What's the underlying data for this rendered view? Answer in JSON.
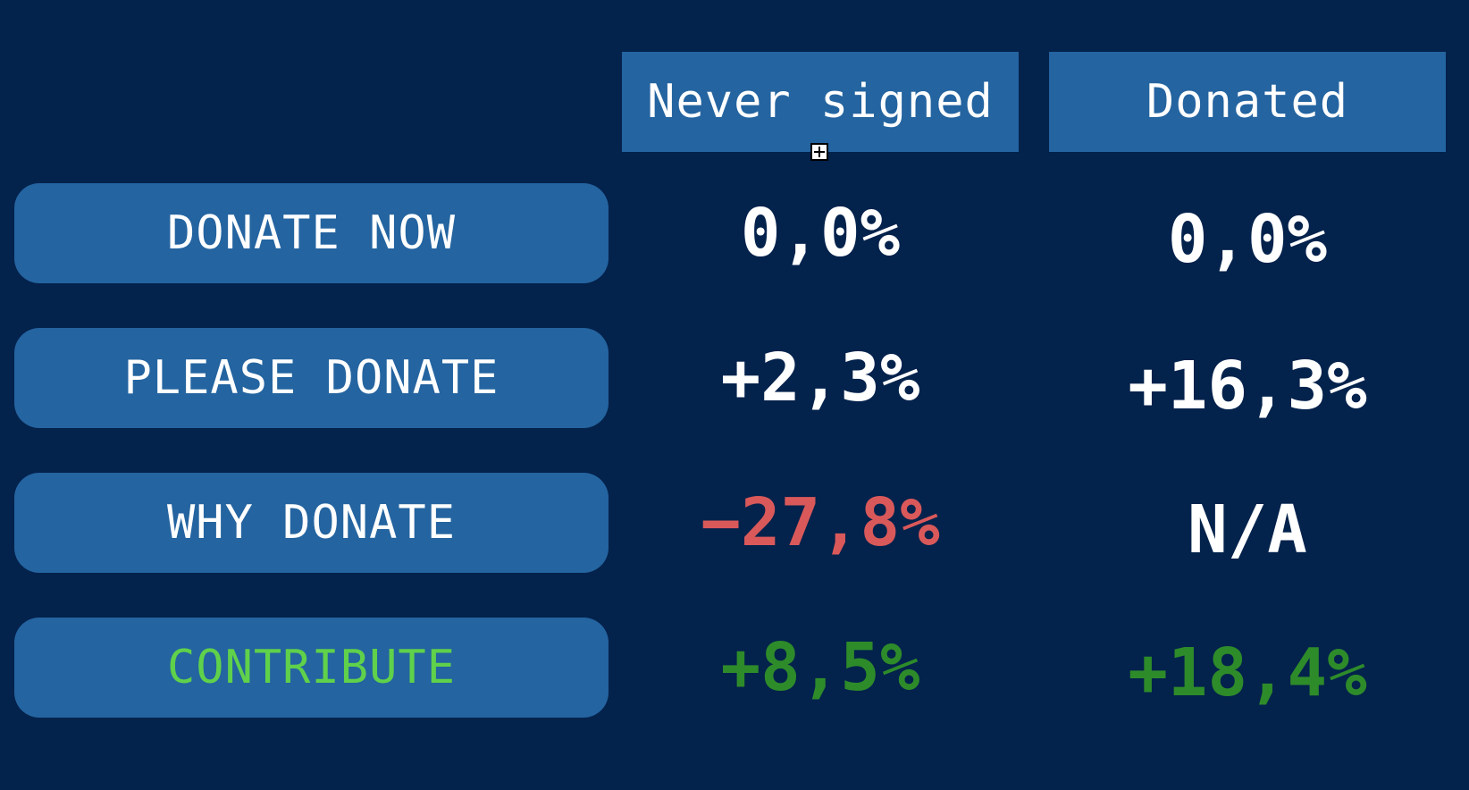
{
  "columns": [
    {
      "label": "Never signed"
    },
    {
      "label": "Donated"
    }
  ],
  "rows": [
    {
      "label": "DONATE NOW",
      "label_color": "#ffffff",
      "values": [
        "0,0%",
        "0,0%"
      ],
      "value_colors": [
        "#ffffff",
        "#ffffff"
      ]
    },
    {
      "label": "PLEASE DONATE",
      "label_color": "#ffffff",
      "values": [
        "+2,3%",
        "+16,3%"
      ],
      "value_colors": [
        "#ffffff",
        "#ffffff"
      ]
    },
    {
      "label": "WHY DONATE",
      "label_color": "#ffffff",
      "values": [
        "−27,8%",
        "N/A"
      ],
      "value_colors": [
        "#d9595a",
        "#ffffff"
      ]
    },
    {
      "label": "CONTRIBUTE",
      "label_color": "#5fd14a",
      "values": [
        "+8,5%",
        "+18,4%"
      ],
      "value_colors": [
        "#2e8b2a",
        "#2e8b2a"
      ]
    }
  ],
  "colors": {
    "background": "#03224c",
    "panel": "#2464a0",
    "negative": "#d9595a",
    "positive": "#2e8b2a",
    "highlight_label": "#5fd14a"
  },
  "icons": {
    "resize_handle": "plus-square-icon"
  }
}
